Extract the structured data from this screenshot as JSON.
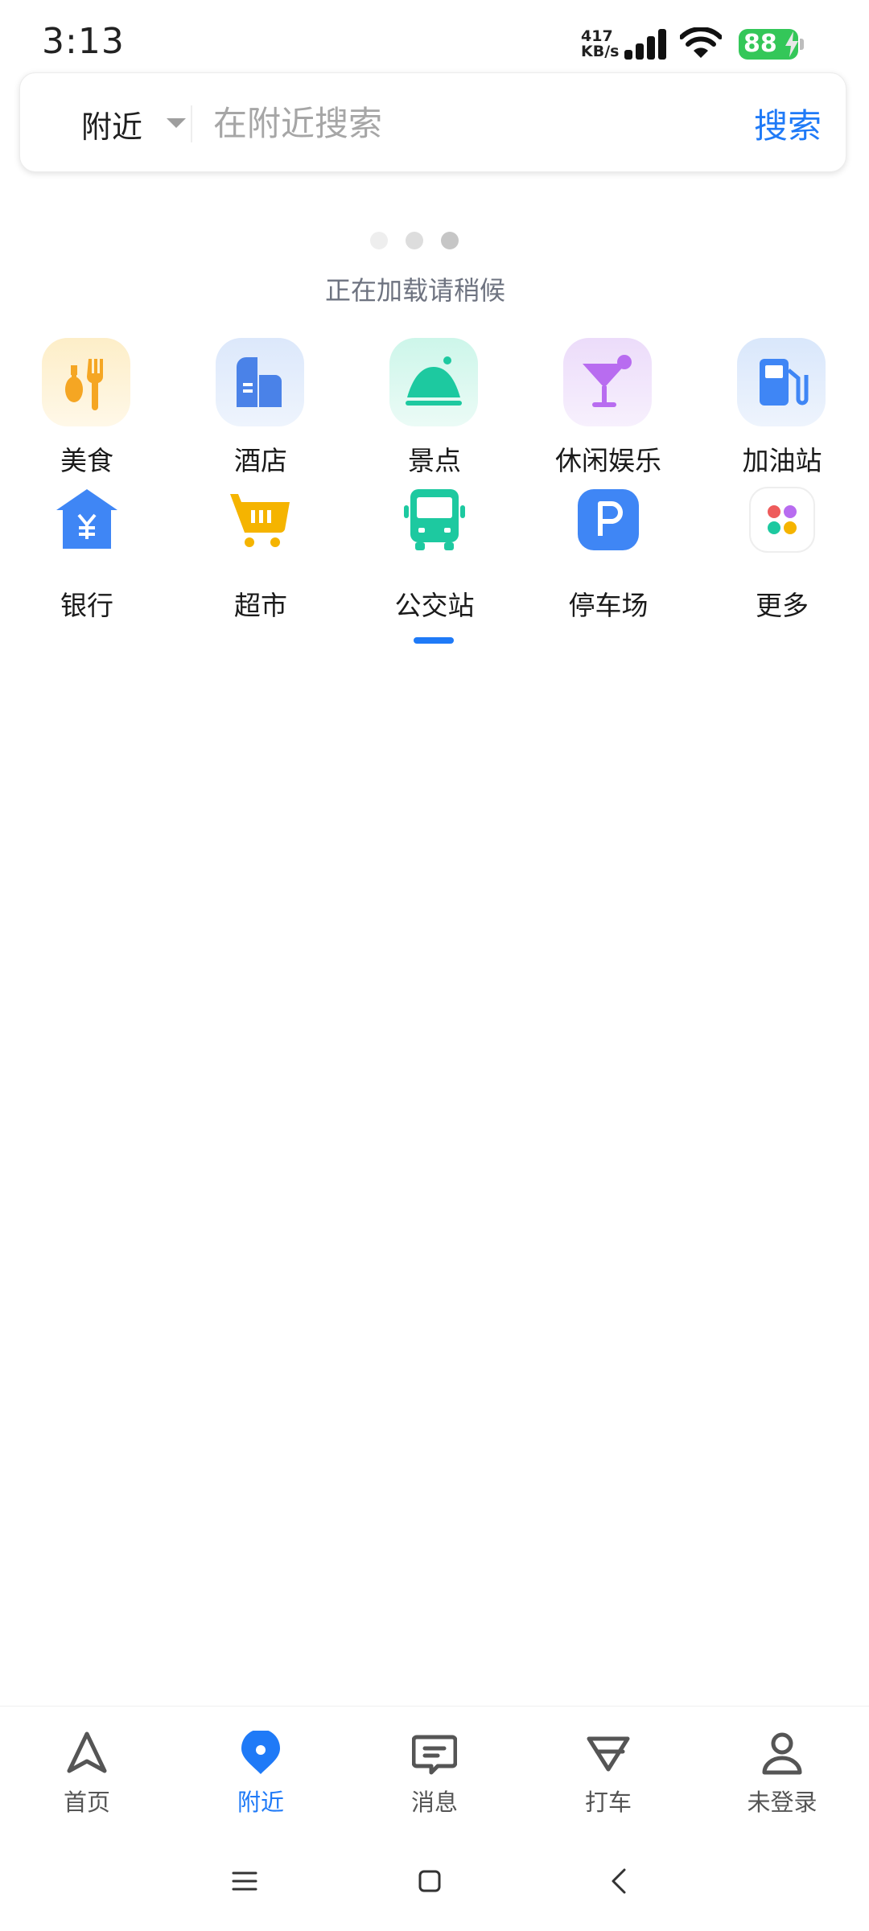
{
  "status_bar": {
    "time": "3:13",
    "net_speed_value": "417",
    "net_speed_unit": "KB/s",
    "battery": "88"
  },
  "search": {
    "scope": "附近",
    "placeholder": "在附近搜索",
    "button": "搜索"
  },
  "loading": {
    "text": "正在加载请稍候"
  },
  "categories": [
    {
      "label": "美食",
      "icon": "fork-spoon-icon",
      "color": "#f5a623"
    },
    {
      "label": "酒店",
      "icon": "hotel-building-icon",
      "color": "#4a82e8"
    },
    {
      "label": "景点",
      "icon": "mountain-icon",
      "color": "#1dc9a0"
    },
    {
      "label": "休闲娱乐",
      "icon": "cocktail-icon",
      "color": "#b86cf0"
    },
    {
      "label": "加油站",
      "icon": "gas-pump-icon",
      "color": "#3f86f5"
    },
    {
      "label": "银行",
      "icon": "bank-yuan-icon",
      "color": "#3f86f5"
    },
    {
      "label": "超市",
      "icon": "shopping-cart-icon",
      "color": "#f5b400"
    },
    {
      "label": "公交站",
      "icon": "bus-icon",
      "color": "#1dc9a0"
    },
    {
      "label": "停车场",
      "icon": "parking-icon",
      "color": "#3f86f5"
    },
    {
      "label": "更多",
      "icon": "more-dots-icon",
      "color": "#aaaaaa"
    }
  ],
  "bottom_nav": [
    {
      "label": "首页",
      "icon": "navigation-arrow-icon",
      "active": false
    },
    {
      "label": "附近",
      "icon": "location-pin-icon",
      "active": true
    },
    {
      "label": "消息",
      "icon": "message-icon",
      "active": false
    },
    {
      "label": "打车",
      "icon": "taxi-icon",
      "active": false
    },
    {
      "label": "未登录",
      "icon": "user-icon",
      "active": false
    }
  ],
  "colors": {
    "accent": "#1f7af7",
    "battery": "#34c759"
  }
}
